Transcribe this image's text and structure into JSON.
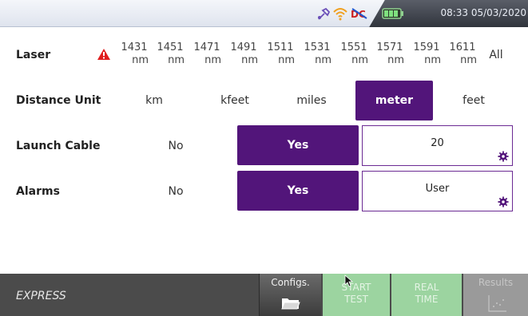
{
  "status": {
    "time": "08:33 05/03/2020",
    "icons": [
      "tools-icon",
      "wifi-icon",
      "power-ac-icon",
      "battery-icon"
    ]
  },
  "laser": {
    "label": "Laser",
    "warning_icon": "warning-icon",
    "wavelengths": [
      {
        "value": "1431",
        "unit": "nm"
      },
      {
        "value": "1451",
        "unit": "nm"
      },
      {
        "value": "1471",
        "unit": "nm"
      },
      {
        "value": "1491",
        "unit": "nm"
      },
      {
        "value": "1511",
        "unit": "nm"
      },
      {
        "value": "1531",
        "unit": "nm"
      },
      {
        "value": "1551",
        "unit": "nm"
      },
      {
        "value": "1571",
        "unit": "nm"
      },
      {
        "value": "1591",
        "unit": "nm"
      },
      {
        "value": "1611",
        "unit": "nm"
      }
    ],
    "all_label": "All"
  },
  "distance_unit": {
    "label": "Distance Unit",
    "options": [
      "km",
      "kfeet",
      "miles",
      "meter",
      "feet"
    ],
    "selected": "meter"
  },
  "launch_cable": {
    "label": "Launch Cable",
    "no_label": "No",
    "yes_label": "Yes",
    "value": "20"
  },
  "alarms": {
    "label": "Alarms",
    "no_label": "No",
    "yes_label": "Yes",
    "value": "User"
  },
  "bottom": {
    "mode": "EXPRESS",
    "configs_label": "Configs.",
    "start_label_1": "START",
    "start_label_2": "TEST",
    "real_label_1": "REAL",
    "real_label_2": "TIME",
    "results_label": "Results"
  },
  "colors": {
    "accent": "#52157a",
    "softkey_green": "#9cd4a0",
    "bottom_bar": "#4b4b4b"
  }
}
